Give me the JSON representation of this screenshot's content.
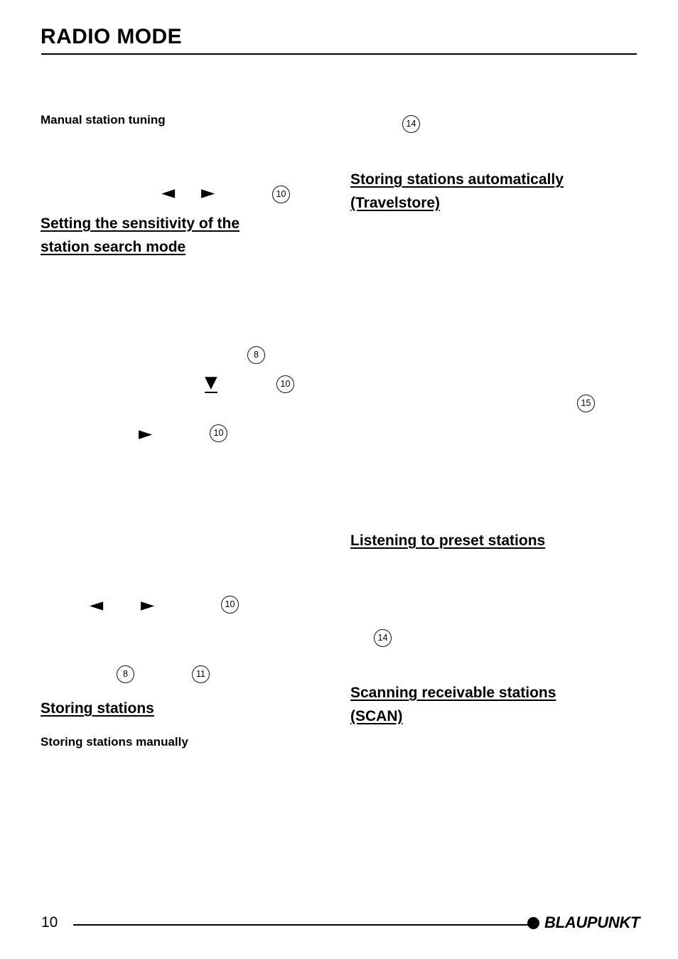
{
  "document": {
    "title": "RADIO MODE",
    "page_number": "10",
    "brand": "BLAUPUNKT"
  },
  "left_column": {
    "subheading_manual_tuning": "Manual station tuning",
    "heading_sensitivity": "Setting the sensitivity of the\nstation search mode",
    "heading_storing_stations": "Storing stations",
    "subheading_storing_manually": "Storing stations manually",
    "arrows": {
      "left_chevron_1": "◄",
      "right_chevron_1": "►",
      "down_chevron": "▼",
      "right_chevron_2": "►",
      "left_chevron_2": "◄",
      "right_chevron_3": "►"
    },
    "callouts": {
      "c10_a": "10",
      "c8_a": "8",
      "c10_b": "10",
      "c10_c": "10",
      "c10_d": "10",
      "c8_b": "8",
      "c11": "11"
    }
  },
  "right_column": {
    "heading_travelstore": "Storing stations automatically\n(Travelstore)",
    "heading_preset_stations": "Listening to preset stations",
    "heading_scan": "Scanning receivable stations\n(SCAN)",
    "callouts": {
      "c14_a": "14",
      "c15": "15",
      "c14_b": "14"
    }
  }
}
